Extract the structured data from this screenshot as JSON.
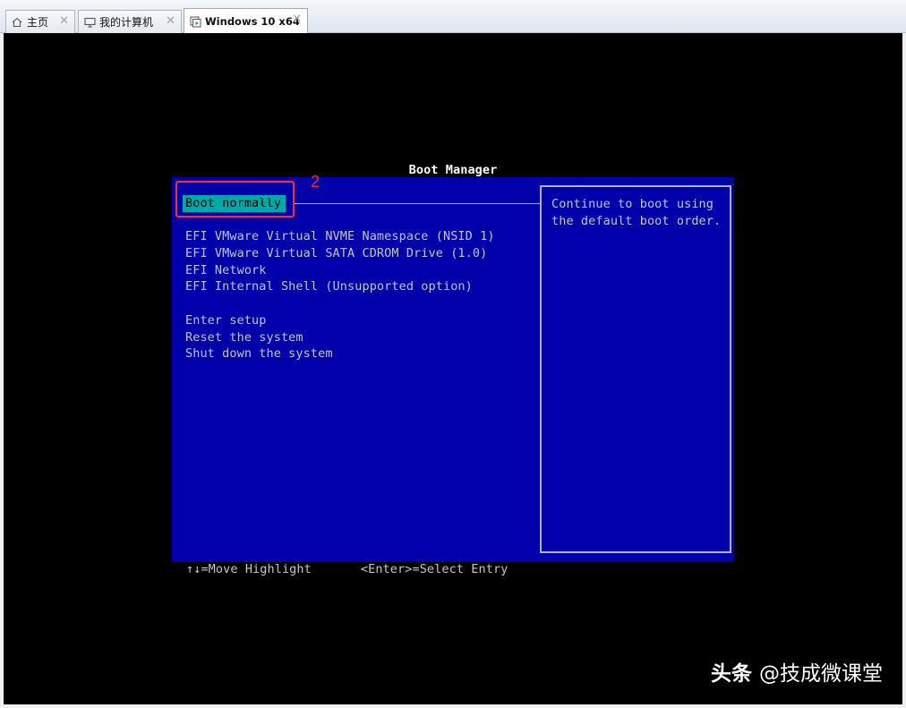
{
  "tabs": [
    {
      "label": "主页",
      "icon": "home-icon",
      "active": false
    },
    {
      "label": "我的计算机",
      "icon": "computer-icon",
      "active": false
    },
    {
      "label": "Windows 10 x64",
      "icon": "vm-icon",
      "active": true
    }
  ],
  "boot_manager": {
    "title": "Boot Manager",
    "selected_item": "Boot normally",
    "items": [
      "EFI VMware Virtual NVME Namespace (NSID 1)",
      "EFI VMware Virtual SATA CDROM Drive (1.0)",
      "EFI Network",
      "EFI Internal Shell (Unsupported option)"
    ],
    "system_items": [
      "Enter setup",
      "Reset the system",
      "Shut down the system"
    ],
    "help_text": "Continue to boot using the default boot order.",
    "footer": {
      "move_hint": "↑↓=Move Highlight",
      "select_hint": "<Enter>=Select Entry"
    }
  },
  "annotation": {
    "label": "2",
    "color": "#ff2a2a"
  },
  "watermark": {
    "brand": "头条",
    "handle": "@技成微课堂"
  },
  "colors": {
    "console_bg": "#000000",
    "panel_bg": "#0000aa",
    "text": "#c6c6c6",
    "highlight_bg": "#00a9a9"
  }
}
